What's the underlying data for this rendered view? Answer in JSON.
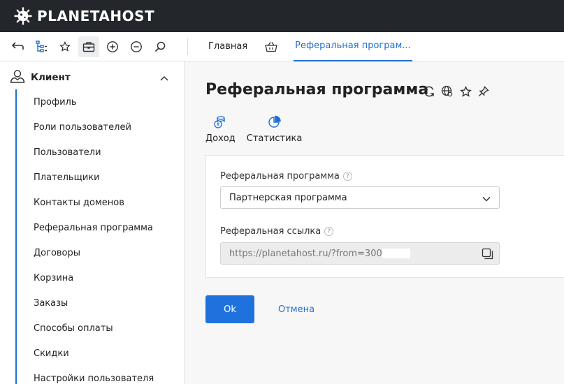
{
  "brand": {
    "name": "PLANETAHOST"
  },
  "toolbar": {
    "icons": [
      "back-icon",
      "tree-icon",
      "star-icon",
      "briefcase-icon",
      "zoom-in-icon",
      "zoom-out-icon",
      "search-icon"
    ],
    "tabs": {
      "home": "Главная",
      "active": "Реферальная програм..."
    }
  },
  "sidebar": {
    "section": "Клиент",
    "items": [
      "Профиль",
      "Роли пользователей",
      "Пользователи",
      "Плательщики",
      "Контакты доменов",
      "Реферальная программа",
      "Договоры",
      "Корзина",
      "Заказы",
      "Способы оплаты",
      "Скидки",
      "Настройки пользователя"
    ]
  },
  "main": {
    "title": "Реферальная программа",
    "subtabs": {
      "income": "Доход",
      "stats": "Статистика"
    },
    "form": {
      "program_label": "Реферальная программа",
      "program_value": "Партнерская программа",
      "link_label": "Реферальная ссылка",
      "link_value": "https://planetahost.ru/?from=300"
    },
    "ok_label": "Ok",
    "cancel_label": "Отмена"
  },
  "colors": {
    "accent": "#1f6fd1",
    "header_bg": "#23262b",
    "button_bg": "#1f72dd"
  }
}
